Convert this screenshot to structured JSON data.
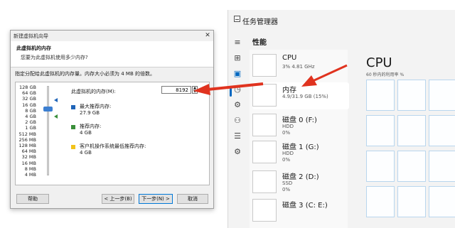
{
  "task_manager": {
    "title": "任务管理器",
    "section": "性能",
    "rail_icons": [
      "hamburger-icon",
      "apps-icon",
      "performance-icon",
      "history-icon",
      "startup-icon",
      "users-icon",
      "details-icon",
      "services-icon"
    ],
    "cards": [
      {
        "name": "CPU",
        "sub1": "3% 4.81 GHz",
        "sub2": ""
      },
      {
        "name": "内存",
        "sub1": "4.9/31.9 GB (15%)",
        "sub2": ""
      },
      {
        "name": "磁盘 0 (F:)",
        "sub1": "HDD",
        "sub2": "0%"
      },
      {
        "name": "磁盘 1 (G:)",
        "sub1": "HDD",
        "sub2": "0%"
      },
      {
        "name": "磁盘 2 (D:)",
        "sub1": "SSD",
        "sub2": "0%"
      },
      {
        "name": "磁盘 3 (C: E:)",
        "sub1": "",
        "sub2": ""
      }
    ],
    "detail_title": "CPU",
    "detail_sub": "60 秒内的利用率 %"
  },
  "wizard": {
    "title": "新建虚拟机向导",
    "close": "✕",
    "heading": "此虚拟机的内存",
    "subheading": "您要为此虚拟机使用多少内存?",
    "instruction": "指定分配给此虚拟机的内存量。内存大小必须为 4 MB 的倍数。",
    "ticks": [
      "128 GB",
      "64 GB",
      "32 GB",
      "16 GB",
      "8 GB",
      "4 GB",
      "2 GB",
      "1 GB",
      "512 MB",
      "256 MB",
      "128 MB",
      "64 MB",
      "32 MB",
      "16 MB",
      "8 MB",
      "4 MB"
    ],
    "memory_label": "此虚拟机的内存(M):",
    "memory_value": "8192",
    "legend": [
      {
        "title": "最大推荐内存:",
        "value": "27.9 GB",
        "color": "#1f64b8"
      },
      {
        "title": "推荐内存:",
        "value": "4 GB",
        "color": "#3a8f3a"
      },
      {
        "title": "客户机操作系统最低推荐内存:",
        "value": "4 GB",
        "color": "#f2c31b"
      }
    ],
    "buttons": {
      "help": "帮助",
      "back": "< 上一步(B)",
      "next": "下一步(N) >",
      "cancel": "取消"
    }
  }
}
